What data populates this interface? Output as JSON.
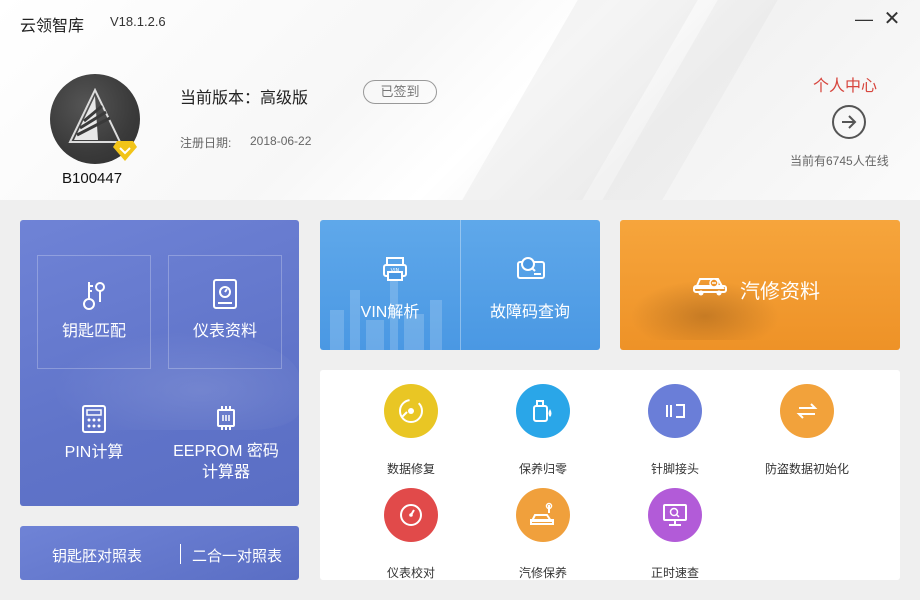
{
  "window": {
    "title": "云领智库",
    "version": "V18.1.2.6",
    "minimize_glyph": "—",
    "close_glyph": "✕"
  },
  "user": {
    "id": "B100447",
    "version_label": "当前版本：高级版",
    "signed_label": "已签到",
    "reg_label": "注册日期:",
    "reg_date": "2018-06-22"
  },
  "personal": {
    "label": "个人中心",
    "online_text": "当前有6745人在线"
  },
  "left_panel": {
    "tiles": [
      "钥匙匹配",
      "仪表资料",
      "PIN计算",
      "EEPROM 密码",
      "计算器"
    ]
  },
  "bottom_bar": {
    "left": "钥匙胚对照表",
    "right": "二合一对照表"
  },
  "vin_panel": {
    "vin_label": "VIN解析",
    "fault_label": "故障码查询"
  },
  "orange_panel": {
    "label": "汽修资料"
  },
  "grid": {
    "items": [
      {
        "label": "数据修复",
        "icon": "disk-repair-icon",
        "color": "#e9c624"
      },
      {
        "label": "保养归零",
        "icon": "oil-can-icon",
        "color": "#2aa6e8"
      },
      {
        "label": "针脚接头",
        "icon": "pin-connector-icon",
        "color": "#6a7ed8"
      },
      {
        "label": "防盗数据初始化",
        "icon": "swap-arrows-icon",
        "color": "#f2a23b"
      },
      {
        "label": "仪表校对",
        "icon": "gauge-icon",
        "color": "#e14a4a"
      },
      {
        "label": "汽修保养",
        "icon": "car-service-icon",
        "color": "#f0a03c"
      },
      {
        "label": "正时速查",
        "icon": "monitor-search-icon",
        "color": "#b25bd8"
      }
    ]
  },
  "colors": {
    "accent_red": "#d7463e",
    "panel_blue": "#6074c9",
    "panel_sky": "#4a98e3",
    "panel_orange": "#ee9227"
  }
}
